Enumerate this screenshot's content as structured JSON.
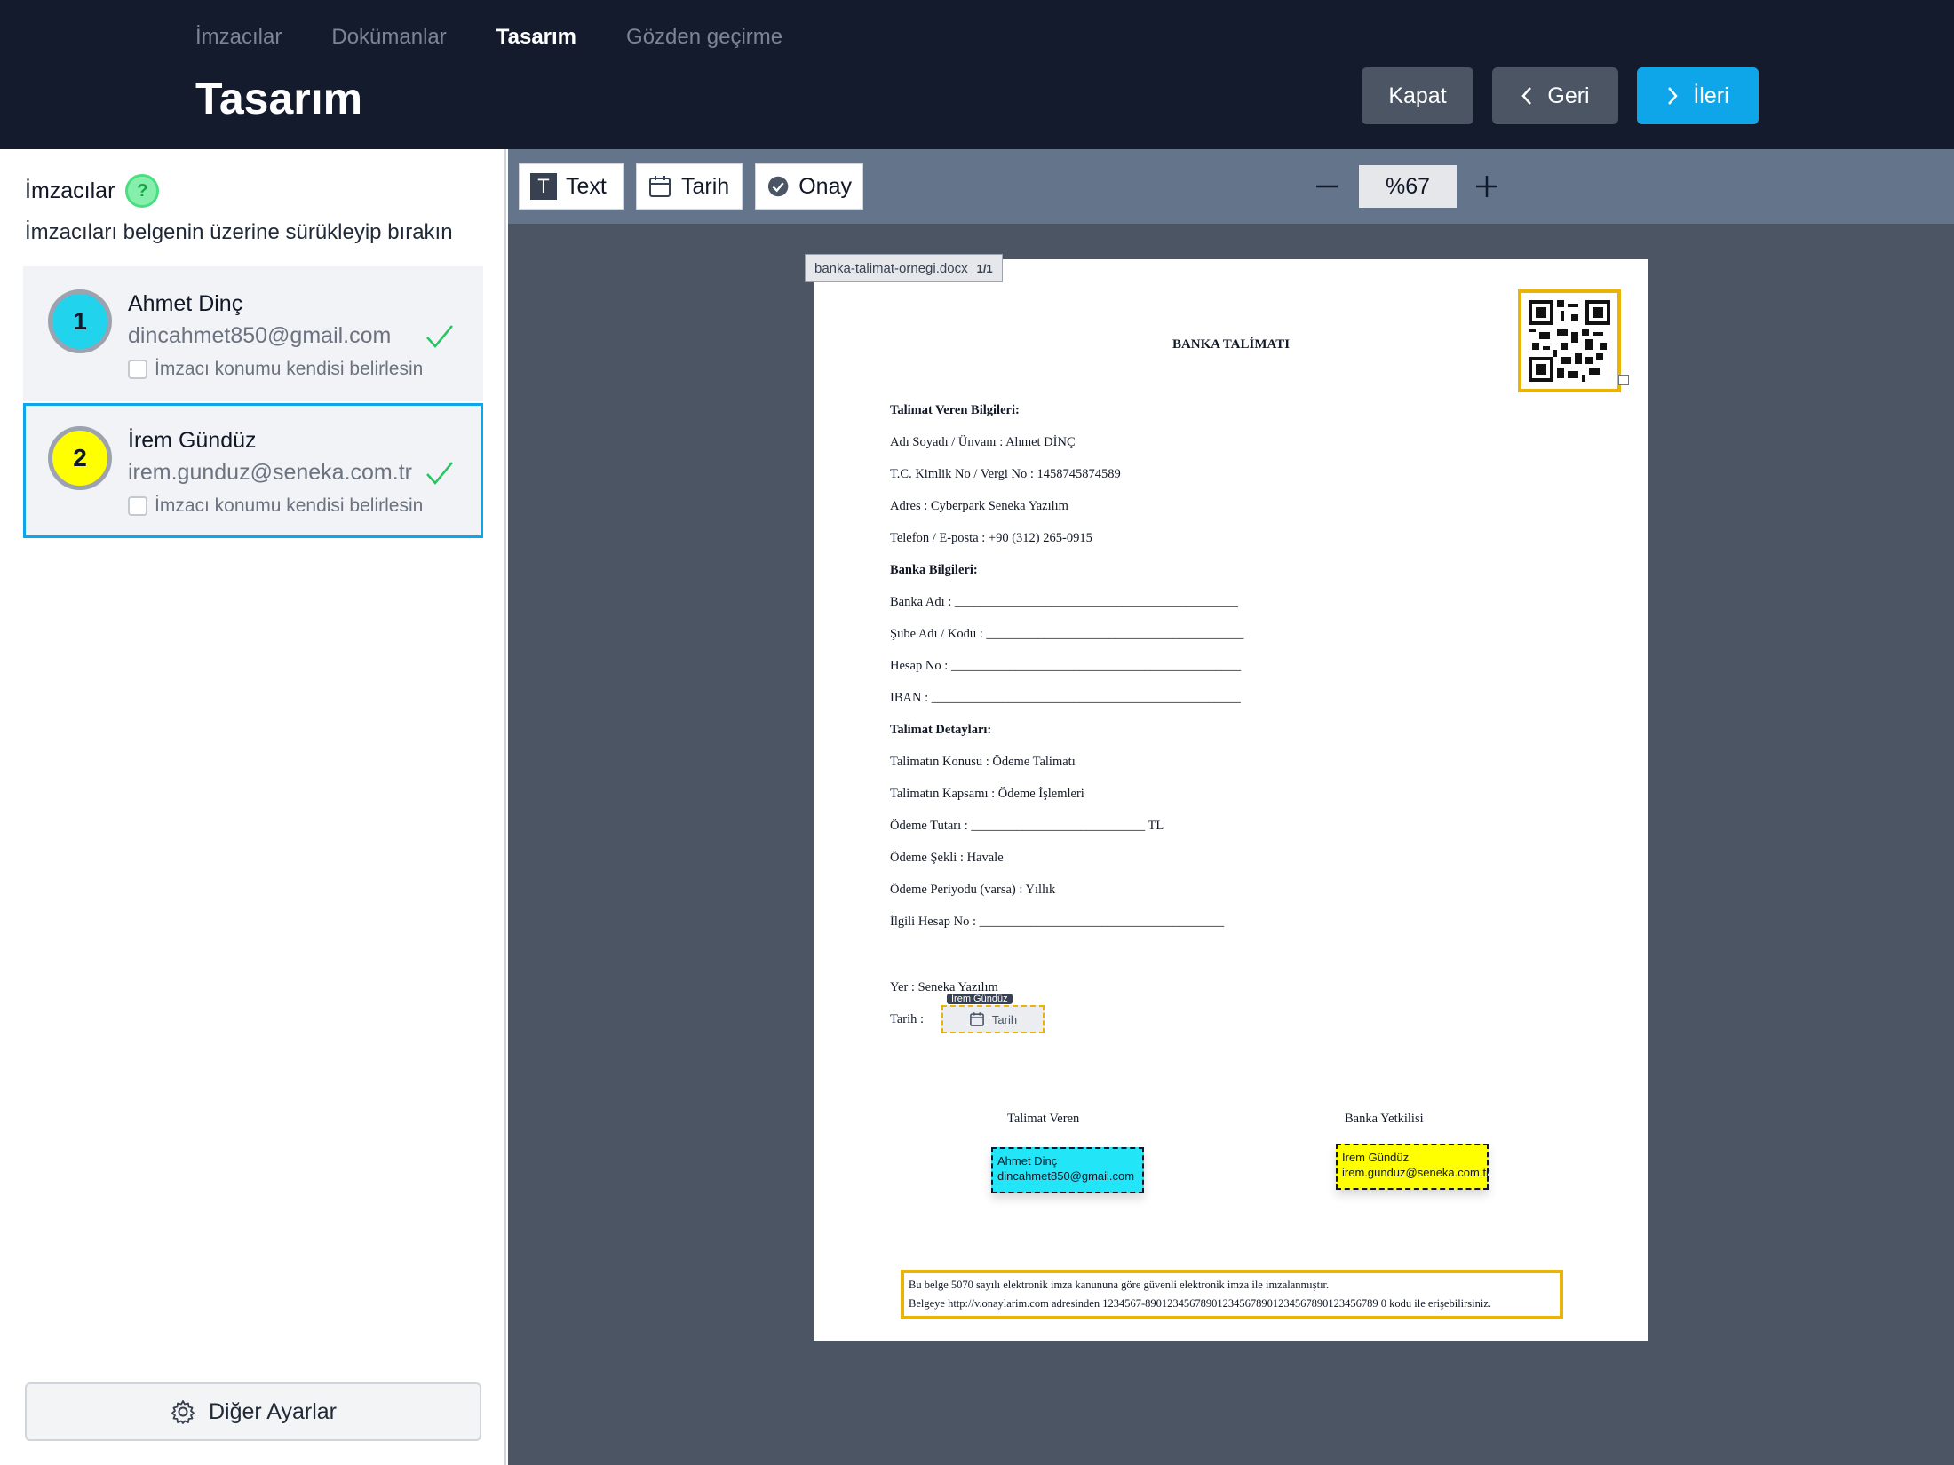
{
  "header": {
    "steps": [
      "İmzacılar",
      "Dokümanlar",
      "Tasarım",
      "Gözden geçirme"
    ],
    "title": "Tasarım",
    "buttons": {
      "close": "Kapat",
      "back": "Geri",
      "next": "İleri"
    }
  },
  "sidebar": {
    "title": "İmzacılar",
    "help_icon": "?",
    "hint": "İmzacıları belgenin üzerine sürükleyip bırakın",
    "signers": [
      {
        "order": "1",
        "name": "Ahmet Dinç",
        "email": "dincahmet850@gmail.com",
        "color": "#22d3ee",
        "option": "İmzacı konumu kendisi belirlesin",
        "option_checked": false,
        "status_icon": "check-icon"
      },
      {
        "order": "2",
        "name": "İrem Gündüz",
        "email": "irem.gunduz@seneka.com.tr",
        "color": "#ffff00",
        "option": "İmzacı konumu kendisi belirlesin",
        "option_checked": false,
        "status_icon": "check-icon",
        "selected": true
      }
    ],
    "settings_button": "Diğer Ayarlar"
  },
  "toolbar": {
    "tools": {
      "text": "Text",
      "date": "Tarih",
      "approval": "Onay"
    },
    "text_icon_glyph": "T",
    "zoom": "%67"
  },
  "document": {
    "file_name": "banka-talimat-ornegi.docx",
    "page": "1/1",
    "title": "BANKA TALİMATI",
    "lines": {
      "l1": "Talimat Veren Bilgileri:",
      "l2": "Adı Soyadı / Ünvanı : Ahmet DİNÇ",
      "l3": "T.C. Kimlik No / Vergi No : 1458745874589",
      "l4": "Adres : Cyberpark Seneka Yazılım",
      "l5": "Telefon / E-posta : +90 (312) 265-0915",
      "l6": "Banka Bilgileri:",
      "l7": "Banka Adı : ____________________________________________",
      "l8": "Şube Adı / Kodu : ________________________________________",
      "l9": "Hesap No : _____________________________________________",
      "l10": "IBAN : ________________________________________________",
      "l11": "Talimat Detayları:",
      "l12": "Talimatın Konusu : Ödeme Talimatı",
      "l13": "Talimatın Kapsamı : Ödeme İşlemleri",
      "l14": "Ödeme Tutarı : ___________________________ TL",
      "l15": "Ödeme Şekli : Havale",
      "l16": "Ödeme Periyodu (varsa) : Yıllık",
      "l17": "İlgili Hesap No : ______________________________________",
      "l18": "Yer : Seneka Yazılım",
      "l19": "Tarih :"
    },
    "date_field": {
      "tag": "İrem Gündüz",
      "label": "Tarih"
    },
    "sign_labels": {
      "left": "Talimat Veren",
      "right": "Banka Yetkilisi"
    },
    "signature_fields": [
      {
        "name": "Ahmet Dinç",
        "email": "dincahmet850@gmail.com",
        "color": "#22e5f8"
      },
      {
        "name": "İrem Gündüz",
        "email": "irem.gunduz@seneka.com.tr",
        "color": "#ffff00"
      }
    ],
    "footer": {
      "line1": "Bu belge 5070 sayılı elektronik imza kanununa göre güvenli elektronik imza ile imzalanmıştır.",
      "line2": "Belgeye http://v.onaylarim.com adresinden 1234567-890123456789012345678901234567890123456789 0 kodu ile erişebilirsiniz."
    }
  }
}
